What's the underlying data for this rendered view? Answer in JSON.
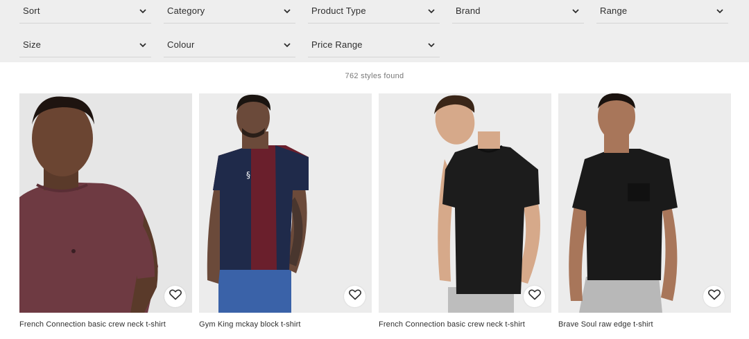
{
  "filters": {
    "row1": [
      {
        "label": "Sort"
      },
      {
        "label": "Category"
      },
      {
        "label": "Product Type"
      },
      {
        "label": "Brand"
      },
      {
        "label": "Range"
      }
    ],
    "row2": [
      {
        "label": "Size"
      },
      {
        "label": "Colour"
      },
      {
        "label": "Price Range"
      }
    ]
  },
  "results": {
    "count_text": "762 styles found"
  },
  "products": [
    {
      "title": "French Connection basic crew neck t-shirt",
      "shirt_color": "#6e3a42",
      "icon": "heart-icon"
    },
    {
      "title": "Gym King mckay block t-shirt",
      "shirt_color": "#6a1f2c",
      "accent_color": "#1f2a4a",
      "icon": "heart-icon"
    },
    {
      "title": "French Connection basic crew neck t-shirt",
      "shirt_color": "#1c1c1c",
      "icon": "heart-icon"
    },
    {
      "title": "Brave Soul raw edge t-shirt",
      "shirt_color": "#1a1a1a",
      "icon": "heart-icon"
    }
  ],
  "colors": {
    "filter_bg": "#eeeeee",
    "photo_bg": "#ececec",
    "text": "#2d2d2d",
    "muted_text": "#777777"
  }
}
